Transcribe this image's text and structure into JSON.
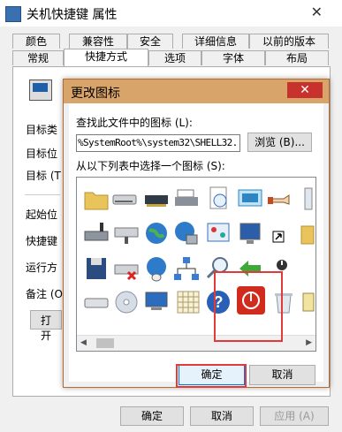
{
  "outer": {
    "title": "关机快捷键 属性",
    "close_glyph": "✕",
    "tabs_row1": [
      "颜色",
      "兼容性",
      "安全",
      "详细信息",
      "以前的版本"
    ],
    "tabs_row2": [
      "常规",
      "快捷方式",
      "选项",
      "字体",
      "布局"
    ],
    "field_labels": [
      "目标类",
      "目标位",
      "目标 (T",
      "起始位",
      "快捷键",
      "运行方",
      "备注 (O"
    ],
    "open_location_label": "打开",
    "buttons": [
      "确定",
      "取消",
      "应用 (A)"
    ]
  },
  "dialog": {
    "title": "更改图标",
    "close_glyph": "✕",
    "path_label": "查找此文件中的图标 (L):",
    "path_value": "%SystemRoot%\\system32\\SHELL32.",
    "browse_label": "浏览 (B)...",
    "list_label": "从以下列表中选择一个图标 (S):",
    "ok_label": "确定",
    "cancel_label": "取消",
    "selected_icon": "power-icon"
  },
  "icons": [
    "folder-icon",
    "drive-icon",
    "memory-chip-icon",
    "printer-icon",
    "clock-document-icon",
    "window-icon",
    "pointing-hand-icon",
    "partial-icon",
    "drive-network-icon",
    "drive-remote-icon",
    "globe-icon",
    "network-globe-icon",
    "control-panel-icon",
    "monitor-icon",
    "shortcut-arrow-icon",
    "folder-doc-icon",
    "floppy-icon",
    "drive-x-icon",
    "globe-mouse-icon",
    "network-icon",
    "search-icon",
    "green-arrow-icon",
    "power-icon",
    "partial-icon",
    "drive-flat-icon",
    "cd-icon",
    "computer-icon",
    "grid-icon",
    "help-icon",
    "power-icon",
    "recycle-bin-icon",
    "partial-icon"
  ],
  "colors": {
    "accent": "#0078d7",
    "dialog_title": "#d9a46a",
    "close_red": "#c7322c",
    "highlight_red": "#e23a3a",
    "power_red": "#d12b1e"
  }
}
